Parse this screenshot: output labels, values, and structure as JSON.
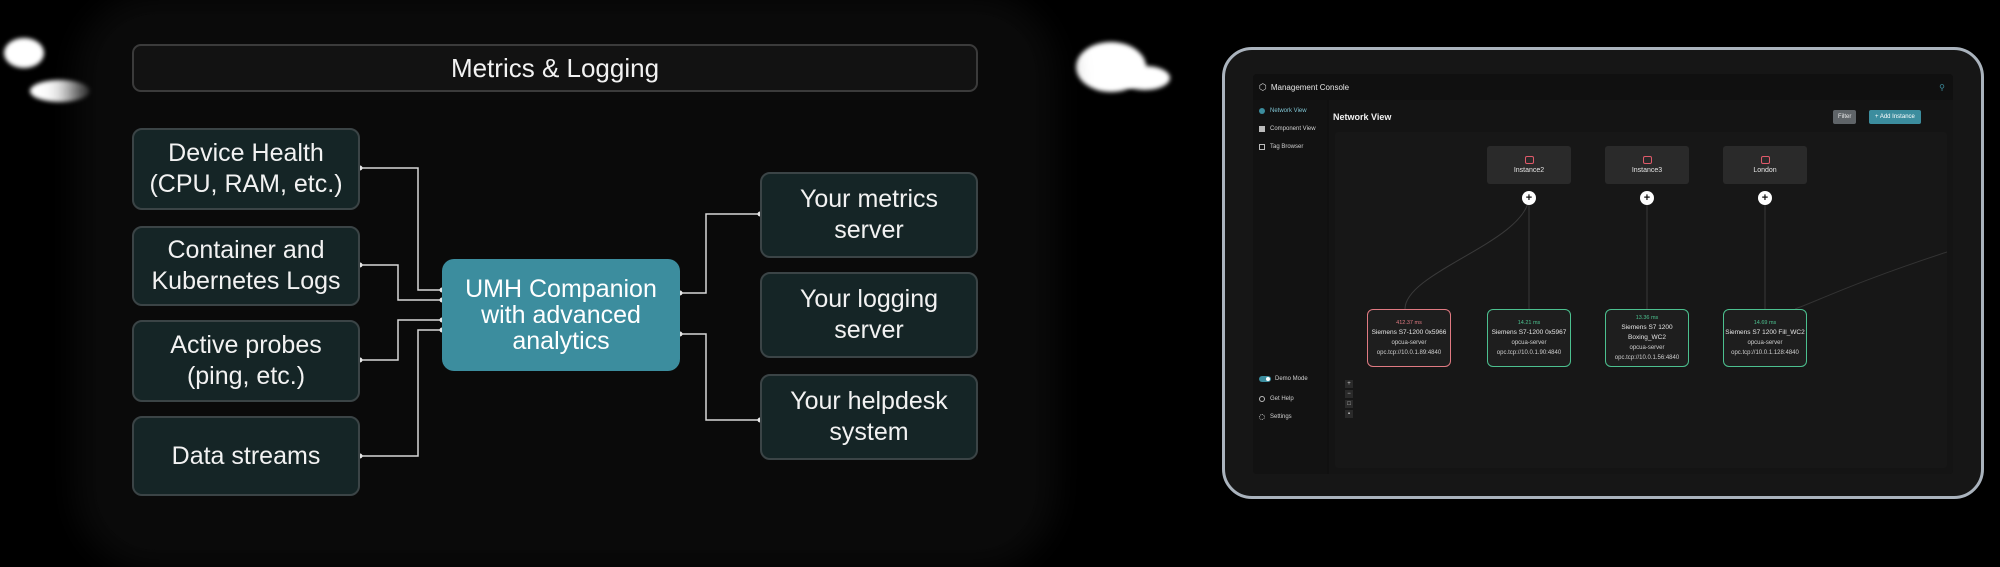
{
  "diagram": {
    "header": "Metrics & Logging",
    "inputs": [
      {
        "label": "Device Health (CPU, RAM, etc.)"
      },
      {
        "label": "Container and Kubernetes Logs"
      },
      {
        "label": "Active probes (ping, etc.)"
      },
      {
        "label": "Data streams"
      }
    ],
    "hub": "UMH Companion with advanced analytics",
    "outputs": [
      {
        "label": "Your metrics server"
      },
      {
        "label": "Your logging server"
      },
      {
        "label": "Your helpdesk system"
      }
    ],
    "colors": {
      "hub": "#3c8d9e",
      "box": "#152526",
      "border": "#3b4446"
    }
  },
  "console": {
    "title": "Management Console",
    "sidebar": {
      "items": [
        {
          "label": "Network View"
        },
        {
          "label": "Component View"
        },
        {
          "label": "Tag Browser"
        }
      ],
      "bottom": [
        {
          "label": "Demo Mode"
        },
        {
          "label": "Get Help"
        },
        {
          "label": "Settings"
        }
      ]
    },
    "page_title": "Network View",
    "filter_label": "Filter",
    "add_label": "+ Add Instance",
    "instances": [
      {
        "name": "Instance2"
      },
      {
        "name": "Instance3"
      },
      {
        "name": "London"
      }
    ],
    "devices": [
      {
        "latency": "412.37 ms",
        "name": "Siemens S7-1200 0x5966",
        "type": "opcua-server",
        "address": "opc.tcp://10.0.1.89:4840",
        "status": "warning"
      },
      {
        "latency": "14.21 ms",
        "name": "Siemens S7-1200 0x5967",
        "type": "opcua-server",
        "address": "opc.tcp://10.0.1.90:4840",
        "status": "ok"
      },
      {
        "latency": "13.36 ms",
        "name": "Siemens S7 1200 Boxing_WC2",
        "type": "opcua-server",
        "address": "opc.tcp://10.0.1.56:4840",
        "status": "ok"
      },
      {
        "latency": "14.69 ms",
        "name": "Siemens S7 1200 Fill_WC2",
        "type": "opcua-server",
        "address": "opc.tcp://10.0.1.128:4840",
        "status": "ok"
      }
    ]
  }
}
